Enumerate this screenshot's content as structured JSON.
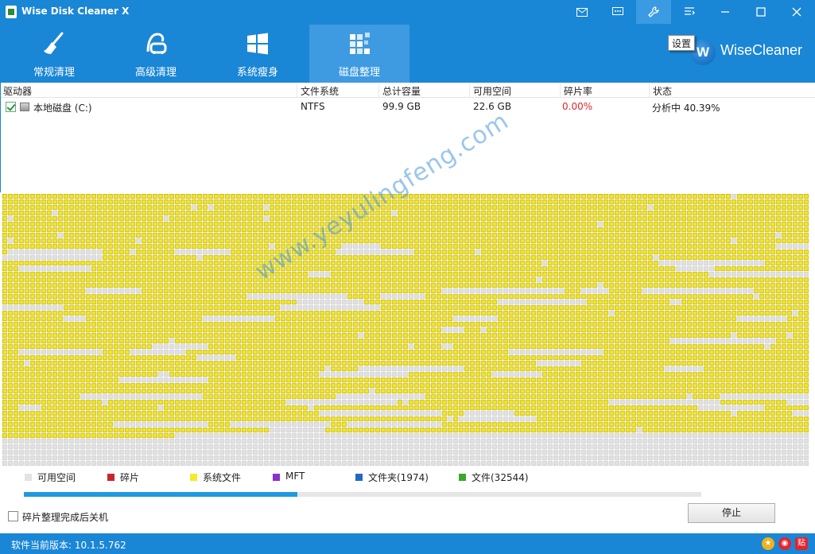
{
  "window": {
    "title": "Wise Disk Cleaner X"
  },
  "toolbar": {
    "items": [
      {
        "label": "常规清理",
        "icon": "broom-icon"
      },
      {
        "label": "高级清理",
        "icon": "vacuum-icon"
      },
      {
        "label": "系统瘦身",
        "icon": "windows-icon"
      },
      {
        "label": "磁盘整理",
        "icon": "defrag-icon",
        "active": true
      }
    ],
    "brand": "WiseCleaner",
    "brand_logo": "W",
    "tooltip": "设置"
  },
  "table": {
    "headers": [
      "驱动器",
      "文件系统",
      "总计容量",
      "可用空间",
      "碎片率",
      "状态"
    ],
    "rows": [
      {
        "drive": "本地磁盘 (C:)",
        "fs": "NTFS",
        "total": "99.9 GB",
        "free": "22.6 GB",
        "frag": "0.00%",
        "status": "分析中 40.39%",
        "checked": true
      }
    ]
  },
  "legend": [
    {
      "label": "可用空间",
      "color": "#e3e3e3"
    },
    {
      "label": "碎片",
      "color": "#c8262d"
    },
    {
      "label": "系统文件",
      "color": "#f6e928"
    },
    {
      "label": "MFT",
      "color": "#8a2fd4"
    },
    {
      "label": "文件夹(1974)",
      "color": "#2268c4"
    },
    {
      "label": "文件(32544)",
      "color": "#3aa829"
    }
  ],
  "progress": {
    "value": 0.4039
  },
  "options": {
    "shutdown_label": "碎片整理完成后关机",
    "stop_label": "停止"
  },
  "statusbar": {
    "version_text": "软件当前版本: 10.1.5.762"
  },
  "watermark": "www.yeyulingfeng.com",
  "colors": {
    "accent": "#1a86d6",
    "frag_red": "#e0262d",
    "system_yellow": "#f6e928",
    "free_gray": "#e3e3e3"
  }
}
